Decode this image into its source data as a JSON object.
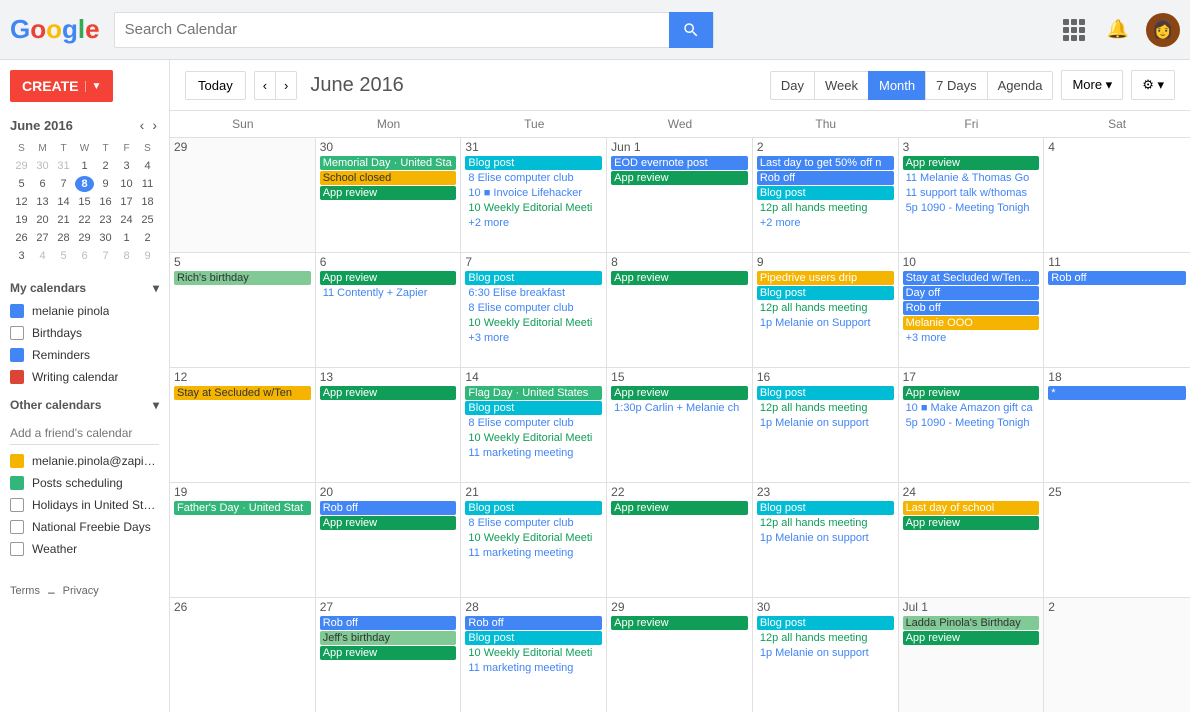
{
  "header": {
    "search_placeholder": "Search Calendar",
    "month_title": "June 2016"
  },
  "toolbar": {
    "today_label": "Today",
    "views": [
      "Day",
      "Week",
      "Month",
      "7 Days",
      "Agenda"
    ],
    "active_view": "Month",
    "more_label": "More ▾",
    "settings_label": "⚙ ▾"
  },
  "sidebar": {
    "create_label": "CREATE",
    "mini_cal": {
      "title": "June 2016",
      "headers": [
        "S",
        "M",
        "T",
        "W",
        "T",
        "F",
        "S"
      ],
      "weeks": [
        [
          "29",
          "30",
          "31",
          "1",
          "2",
          "3",
          "4"
        ],
        [
          "5",
          "6",
          "7",
          "8",
          "9",
          "10",
          "11"
        ],
        [
          "12",
          "13",
          "14",
          "15",
          "16",
          "17",
          "18"
        ],
        [
          "19",
          "20",
          "21",
          "22",
          "23",
          "24",
          "25"
        ],
        [
          "26",
          "27",
          "28",
          "29",
          "30",
          "1",
          "2"
        ],
        [
          "3",
          "4",
          "5",
          "6",
          "7",
          "8",
          "9"
        ]
      ],
      "other_month_days": [
        "29",
        "30",
        "31",
        "1",
        "2",
        "3",
        "4",
        "5",
        "6",
        "7",
        "8",
        "9"
      ],
      "today": "8"
    },
    "my_calendars_title": "My calendars",
    "my_calendars": [
      {
        "label": "melanie pinola",
        "color": "#4285F4",
        "type": "solid"
      },
      {
        "label": "Birthdays",
        "color": "",
        "type": "checkbox"
      },
      {
        "label": "Reminders",
        "color": "#4285F4",
        "type": "solid"
      },
      {
        "label": "Writing calendar",
        "color": "#DB4437",
        "type": "solid"
      }
    ],
    "other_calendars_title": "Other calendars",
    "add_friend_placeholder": "Add a friend's calendar",
    "other_calendars": [
      {
        "label": "melanie.pinola@zapie...",
        "color": "#F4B400",
        "type": "solid"
      },
      {
        "label": "Posts scheduling",
        "color": "#33b679",
        "type": "solid"
      },
      {
        "label": "Holidays in United Sta...",
        "color": "",
        "type": "checkbox"
      },
      {
        "label": "National Freebie Days",
        "color": "",
        "type": "checkbox"
      },
      {
        "label": "Weather",
        "color": "",
        "type": "checkbox"
      }
    ],
    "terms_label": "Terms",
    "privacy_label": "Privacy"
  },
  "calendar": {
    "day_headers": [
      "Sun",
      "Mon",
      "Tue",
      "Wed",
      "Thu",
      "Fri",
      "Sat"
    ],
    "weeks": [
      {
        "days": [
          {
            "num": "29",
            "other": true,
            "events": []
          },
          {
            "num": "30",
            "other": false,
            "events": [
              {
                "text": "Memorial Day · United Sta",
                "style": "holiday-green"
              },
              {
                "text": "School closed",
                "style": "event-yellow"
              },
              {
                "text": "App review",
                "style": "event-green"
              }
            ]
          },
          {
            "num": "31",
            "other": false,
            "events": [
              {
                "text": "Blog post",
                "style": "event-teal"
              },
              {
                "text": "8 Elise computer club",
                "style": "event-text"
              },
              {
                "text": "10 ■ Invoice Lifehacker",
                "style": "event-text"
              },
              {
                "text": "10 Weekly Editorial Meeti",
                "style": "event-text-green"
              },
              {
                "text": "+2 more",
                "style": "more-link"
              }
            ]
          },
          {
            "num": "Jun 1",
            "other": false,
            "events": [
              {
                "text": "EOD evernote post",
                "style": "event-blue"
              },
              {
                "text": "App review",
                "style": "event-green"
              }
            ]
          },
          {
            "num": "2",
            "other": false,
            "events": [
              {
                "text": "Last day to get 50% off n",
                "style": "event-blue"
              },
              {
                "text": "Rob off",
                "style": "event-blue"
              },
              {
                "text": "Blog post",
                "style": "event-teal"
              },
              {
                "text": "12p all hands meeting",
                "style": "event-text-green"
              },
              {
                "text": "+2 more",
                "style": "more-link"
              }
            ]
          },
          {
            "num": "3",
            "other": false,
            "events": [
              {
                "text": "App review",
                "style": "event-green"
              },
              {
                "text": "11 Melanie & Thomas Go",
                "style": "event-text"
              },
              {
                "text": "11 support talk w/thomas",
                "style": "event-text"
              },
              {
                "text": "5p 1090 - Meeting Tonigh",
                "style": "event-text"
              }
            ]
          },
          {
            "num": "4",
            "other": false,
            "events": []
          }
        ]
      },
      {
        "days": [
          {
            "num": "5",
            "other": false,
            "events": [
              {
                "text": "Rich's birthday",
                "style": "event-light-green"
              }
            ]
          },
          {
            "num": "6",
            "other": false,
            "events": [
              {
                "text": "App review",
                "style": "event-green"
              },
              {
                "text": "11 Contently + Zapier",
                "style": "event-text"
              }
            ]
          },
          {
            "num": "7",
            "other": false,
            "events": [
              {
                "text": "Blog post",
                "style": "event-teal"
              },
              {
                "text": "6:30 Elise breakfast",
                "style": "event-text"
              },
              {
                "text": "8 Elise computer club",
                "style": "event-text"
              },
              {
                "text": "10 Weekly Editorial Meeti",
                "style": "event-text-green"
              },
              {
                "text": "+3 more",
                "style": "more-link"
              }
            ]
          },
          {
            "num": "8",
            "other": false,
            "today": true,
            "events": [
              {
                "text": "App review",
                "style": "event-green"
              }
            ]
          },
          {
            "num": "9",
            "other": false,
            "events": [
              {
                "text": "Pipedrive users drip",
                "style": "event-orange"
              },
              {
                "text": "Blog post",
                "style": "event-teal"
              },
              {
                "text": "12p all hands meeting",
                "style": "event-text-green"
              },
              {
                "text": "1p Melanie on Support",
                "style": "event-text"
              }
            ]
          },
          {
            "num": "10",
            "other": false,
            "events": [
              {
                "text": "Stay at Secluded w/Tennis/Koi Pond/Hot Tub · Secl",
                "style": "event-blue"
              },
              {
                "text": "Day off",
                "style": "event-blue"
              },
              {
                "text": "Rob off",
                "style": "event-blue"
              },
              {
                "text": "Melanie OOO",
                "style": "event-orange"
              },
              {
                "text": "+3 more",
                "style": "more-link"
              }
            ]
          },
          {
            "num": "11",
            "other": false,
            "events": [
              {
                "text": "Rob off",
                "style": "event-blue"
              }
            ]
          }
        ]
      },
      {
        "days": [
          {
            "num": "12",
            "other": false,
            "events": [
              {
                "text": "Stay at Secluded w/Ten",
                "style": "event-yellow"
              }
            ]
          },
          {
            "num": "13",
            "other": false,
            "events": [
              {
                "text": "App review",
                "style": "event-green"
              }
            ]
          },
          {
            "num": "14",
            "other": false,
            "events": [
              {
                "text": "Flag Day · United States",
                "style": "holiday-green"
              },
              {
                "text": "Blog post",
                "style": "event-teal"
              },
              {
                "text": "8 Elise computer club",
                "style": "event-text"
              },
              {
                "text": "10 Weekly Editorial Meeti",
                "style": "event-text-green"
              },
              {
                "text": "11 marketing meeting",
                "style": "event-text"
              }
            ]
          },
          {
            "num": "15",
            "other": false,
            "events": [
              {
                "text": "App review",
                "style": "event-green"
              },
              {
                "text": "1:30p Carlin + Melanie ch",
                "style": "event-text"
              }
            ]
          },
          {
            "num": "16",
            "other": false,
            "events": [
              {
                "text": "Blog post",
                "style": "event-teal"
              },
              {
                "text": "12p all hands meeting",
                "style": "event-text-green"
              },
              {
                "text": "1p Melanie on support",
                "style": "event-text"
              }
            ]
          },
          {
            "num": "17",
            "other": false,
            "events": [
              {
                "text": "App review",
                "style": "event-green"
              },
              {
                "text": "10 ■ Make Amazon gift ca",
                "style": "event-text"
              },
              {
                "text": "5p 1090 - Meeting Tonigh",
                "style": "event-text"
              }
            ]
          },
          {
            "num": "18",
            "other": false,
            "events": [
              {
                "text": "*",
                "style": "event-blue"
              }
            ]
          }
        ]
      },
      {
        "days": [
          {
            "num": "19",
            "other": false,
            "events": [
              {
                "text": "Father's Day · United Stat",
                "style": "holiday-green"
              }
            ]
          },
          {
            "num": "20",
            "other": false,
            "events": [
              {
                "text": "Rob off",
                "style": "event-blue"
              },
              {
                "text": "App review",
                "style": "event-green"
              }
            ]
          },
          {
            "num": "21",
            "other": false,
            "events": [
              {
                "text": "Blog post",
                "style": "event-teal"
              },
              {
                "text": "8 Elise computer club",
                "style": "event-text"
              },
              {
                "text": "10 Weekly Editorial Meeti",
                "style": "event-text-green"
              },
              {
                "text": "11 marketing meeting",
                "style": "event-text"
              }
            ]
          },
          {
            "num": "22",
            "other": false,
            "events": [
              {
                "text": "App review",
                "style": "event-green"
              }
            ]
          },
          {
            "num": "23",
            "other": false,
            "events": [
              {
                "text": "Blog post",
                "style": "event-teal"
              },
              {
                "text": "12p all hands meeting",
                "style": "event-text-green"
              },
              {
                "text": "1p Melanie on support",
                "style": "event-text"
              }
            ]
          },
          {
            "num": "24",
            "other": false,
            "events": [
              {
                "text": "Last day of school",
                "style": "event-orange"
              },
              {
                "text": "App review",
                "style": "event-green"
              }
            ]
          },
          {
            "num": "25",
            "other": false,
            "events": []
          }
        ]
      },
      {
        "days": [
          {
            "num": "26",
            "other": false,
            "events": []
          },
          {
            "num": "27",
            "other": false,
            "events": [
              {
                "text": "Rob off",
                "style": "event-blue"
              },
              {
                "text": "Jeff's birthday",
                "style": "event-light-green"
              },
              {
                "text": "App review",
                "style": "event-green"
              }
            ]
          },
          {
            "num": "28",
            "other": false,
            "events": [
              {
                "text": "Rob off",
                "style": "event-blue"
              },
              {
                "text": "Blog post",
                "style": "event-teal"
              },
              {
                "text": "10 Weekly Editorial Meeti",
                "style": "event-text-green"
              },
              {
                "text": "11 marketing meeting",
                "style": "event-text"
              }
            ]
          },
          {
            "num": "29",
            "other": false,
            "events": [
              {
                "text": "App review",
                "style": "event-green"
              }
            ]
          },
          {
            "num": "30",
            "other": false,
            "events": [
              {
                "text": "Blog post",
                "style": "event-teal"
              },
              {
                "text": "12p all hands meeting",
                "style": "event-text-green"
              },
              {
                "text": "1p Melanie on support",
                "style": "event-text"
              }
            ]
          },
          {
            "num": "Jul 1",
            "other": true,
            "events": [
              {
                "text": "Ladda Pinola's Birthday",
                "style": "event-light-green"
              },
              {
                "text": "App review",
                "style": "event-green"
              }
            ]
          },
          {
            "num": "2",
            "other": true,
            "events": []
          }
        ]
      }
    ]
  }
}
